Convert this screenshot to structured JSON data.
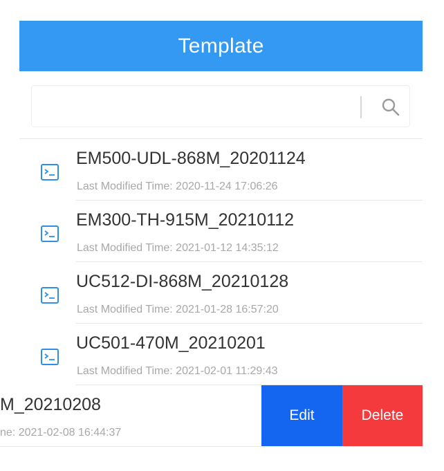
{
  "header": {
    "title": "Template"
  },
  "search": {
    "value": "",
    "placeholder": ""
  },
  "templates": [
    {
      "name": "EM500-UDL-868M_20201124",
      "time": "Last Modified Time: 2020-11-24 17:06:26"
    },
    {
      "name": "EM300-TH-915M_20210112",
      "time": "Last Modified Time: 2021-01-12 14:35:12"
    },
    {
      "name": "UC512-DI-868M_20210128",
      "time": "Last Modified Time: 2021-01-28 16:57:20"
    },
    {
      "name": "UC501-470M_20210201",
      "time": "Last Modified Time: 2021-02-01 11:29:43"
    },
    {
      "name": "M_20210208",
      "time": "ne: 2021-02-08 16:44:37"
    }
  ],
  "actions": {
    "edit_label": "Edit",
    "delete_label": "Delete"
  },
  "icons": {
    "item": "terminal-file-icon",
    "search": "search-icon"
  },
  "colors": {
    "header": "#3399f3",
    "edit": "#1466f0",
    "delete": "#f43a3c",
    "icon": "#2f8fe6"
  }
}
